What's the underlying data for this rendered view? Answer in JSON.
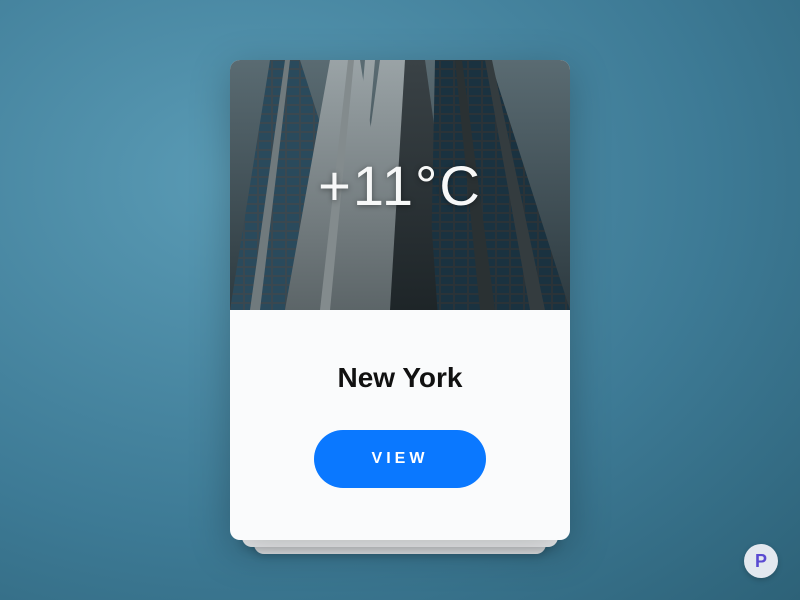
{
  "card": {
    "temperature": "+11°C",
    "city": "New York",
    "button_label": "VIEW"
  },
  "brand": {
    "letter": "P"
  },
  "colors": {
    "accent": "#0a78ff"
  }
}
